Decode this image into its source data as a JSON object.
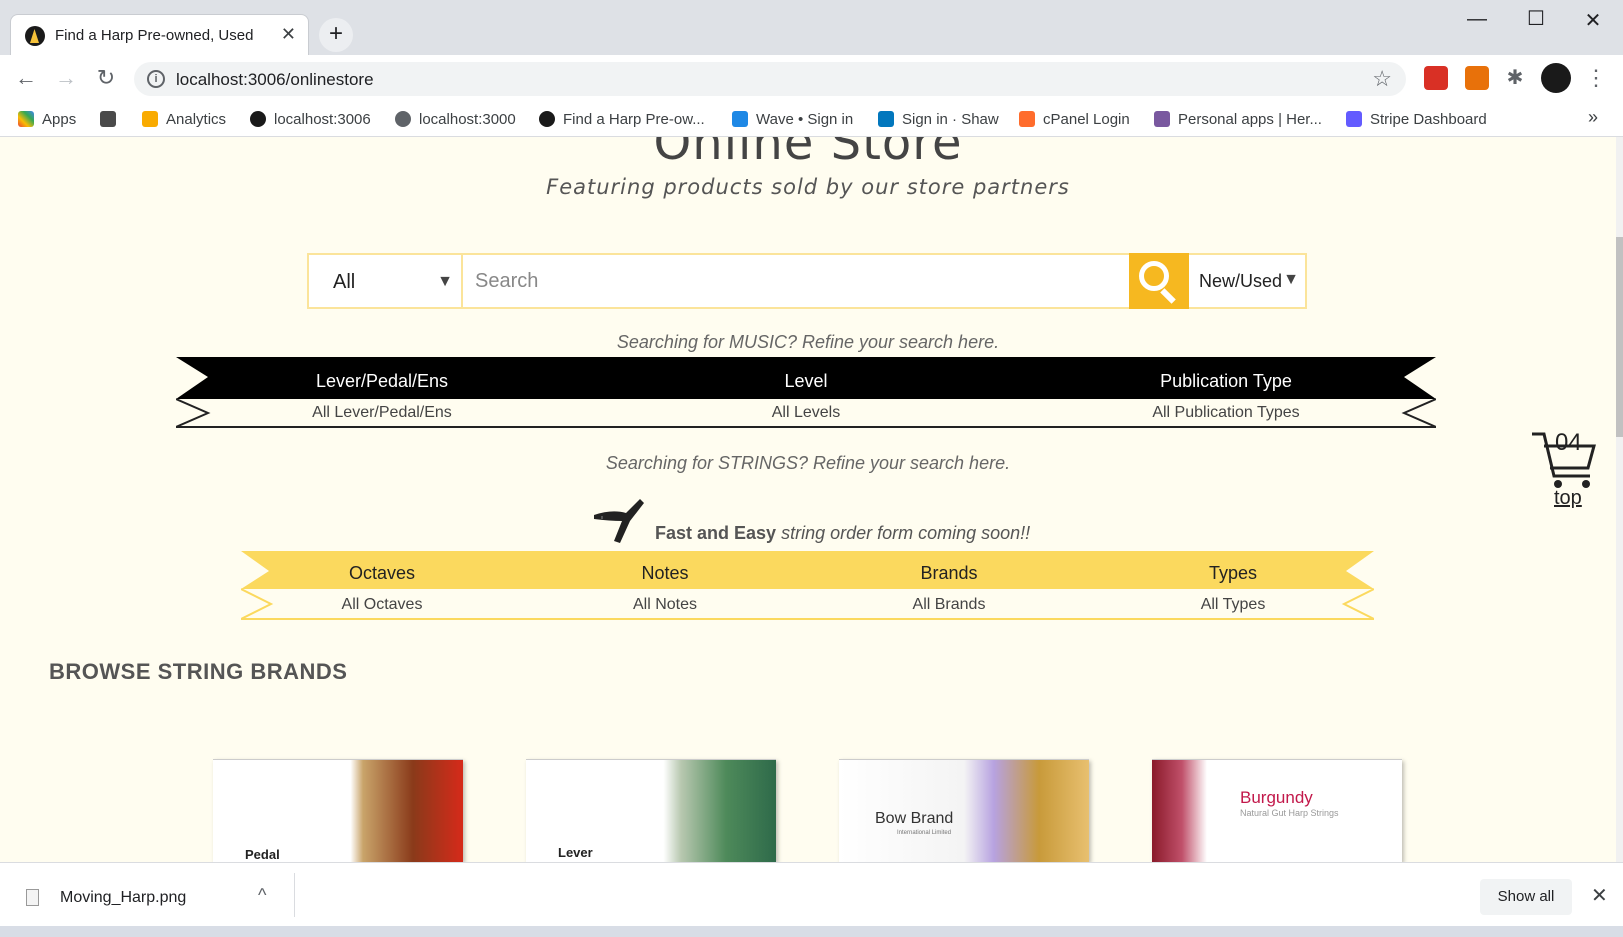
{
  "browser": {
    "tab_title": "Find a Harp Pre-owned, Used",
    "url": "localhost:3006/onlinestore",
    "bookmarks": [
      "Apps",
      "Analytics",
      "localhost:3006",
      "localhost:3000",
      "Find a Harp Pre-ow...",
      "Wave • Sign in",
      "Sign in · Shaw",
      "cPanel Login",
      "Personal apps | Her...",
      "Stripe Dashboard"
    ]
  },
  "page": {
    "title": "Online Store",
    "subtitle": "Featuring products sold by our store partners",
    "search": {
      "category": "All",
      "placeholder": "Search",
      "condition": "New/Used"
    },
    "music_hint": "Searching for MUSIC? Refine your search here.",
    "music_filters": [
      {
        "label": "Lever/Pedal/Ens",
        "value": "All Lever/Pedal/Ens"
      },
      {
        "label": "Level",
        "value": "All Levels"
      },
      {
        "label": "Publication Type",
        "value": "All Publication Types"
      }
    ],
    "strings_hint": "Searching for STRINGS? Refine your search here.",
    "strings_promo_bold": "Fast and Easy",
    "strings_promo_rest": "string order form coming soon!!",
    "string_filters": [
      {
        "label": "Octaves",
        "value": "All Octaves"
      },
      {
        "label": "Notes",
        "value": "All Notes"
      },
      {
        "label": "Brands",
        "value": "All Brands"
      },
      {
        "label": "Types",
        "value": "All Types"
      }
    ],
    "browse_title": "BROWSE STRING BRANDS",
    "brands": [
      {
        "label": "Pedal"
      },
      {
        "label": "Lever"
      },
      {
        "label": "Bow Brand",
        "sub": "International Limited"
      },
      {
        "label": "Burgundy",
        "sub": "Natural Gut Harp Strings"
      }
    ],
    "cart_count": "04",
    "top_link": "top"
  },
  "downloads": {
    "file": "Moving_Harp.png",
    "show_all": "Show all"
  },
  "colors": {
    "accent_yellow": "#f6b820",
    "ribbon_yellow": "#fbd95e",
    "page_bg": "#fffdf0"
  }
}
